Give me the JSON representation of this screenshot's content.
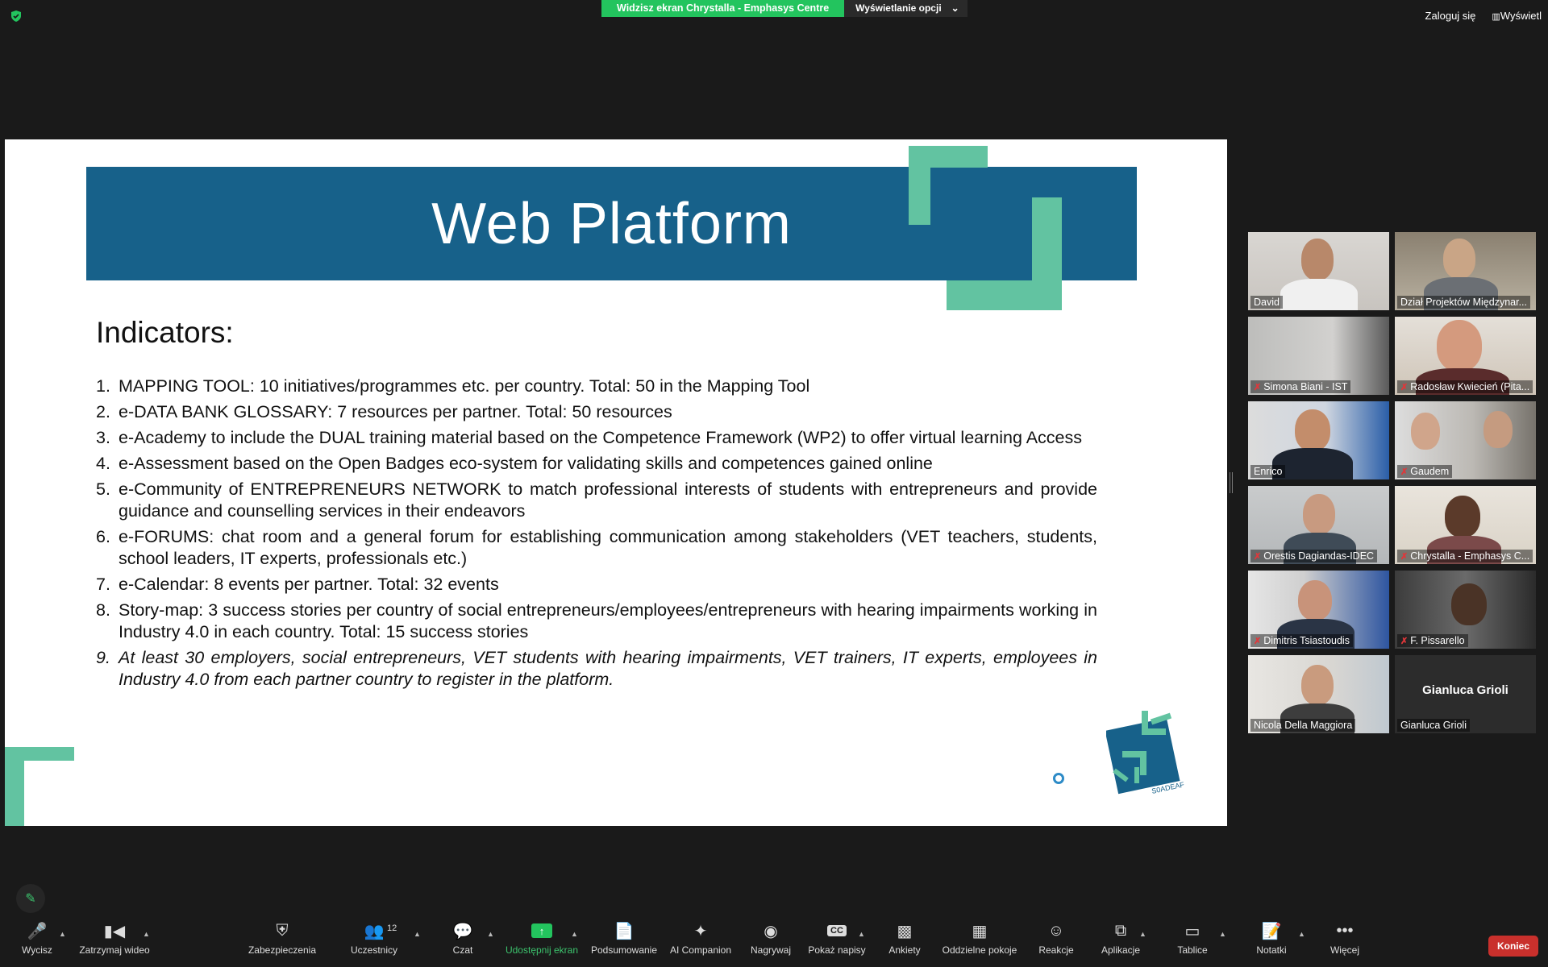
{
  "share_banner": {
    "text": "Widzisz ekran Chrystalla - Emphasys Centre",
    "options": "Wyświetlanie opcji"
  },
  "top_right": {
    "login": "Zaloguj się",
    "view": "Wyświetl"
  },
  "slide": {
    "title": "Web Platform",
    "heading": "Indicators:",
    "items": [
      {
        "num": "1.",
        "text": "MAPPING TOOL: 10 initiatives/programmes etc. per country. Total: 50 in the Mapping Tool"
      },
      {
        "num": "2.",
        "text": "e-DATA BANK GLOSSARY: 7 resources per partner. Total: 50 resources"
      },
      {
        "num": "3.",
        "text": "e-Academy to include the DUAL training material based on the Competence Framework (WP2) to offer virtual learning Access"
      },
      {
        "num": "4.",
        "text": "e-Assessment based on the Open Badges eco-system for validating skills and competences gained online"
      },
      {
        "num": "5.",
        "text": "e-Community of ENTREPRENEURS NETWORK to match professional interests of students with entrepreneurs and provide guidance and counselling services in their endeavors"
      },
      {
        "num": "6.",
        "text": "e-FORUMS: chat room and a general forum for establishing communication among stakeholders (VET teachers, students, school leaders, IT experts, professionals etc.)"
      },
      {
        "num": "7.",
        "text": "e-Calendar: 8 events per partner. Total: 32 events"
      },
      {
        "num": "8.",
        "text": "Story-map: 3 success stories per country of social entrepreneurs/employees/entrepreneurs with hearing impairments working in Industry 4.0 in each country. Total: 15 success stories"
      },
      {
        "num": "9.",
        "text": "At least 30 employers, social entrepreneurs, VET students with hearing impairments, VET trainers, IT experts, employees in Industry 4.0 from each partner country to register in the platform."
      }
    ],
    "logo_text": "S0ADEAF"
  },
  "participants": [
    {
      "name": "David",
      "muted": false
    },
    {
      "name": "Dział Projektów Międzynar...",
      "muted": false
    },
    {
      "name": "Simona Biani - IST",
      "muted": true
    },
    {
      "name": "Radosław Kwiecień (Pita...",
      "muted": true
    },
    {
      "name": "Enrico",
      "muted": false
    },
    {
      "name": "Gaudem",
      "muted": true
    },
    {
      "name": "Orestis Dagiandas-IDEC",
      "muted": true
    },
    {
      "name": "Chrystalla - Emphasys C...",
      "muted": true
    },
    {
      "name": "Dimitris Tsiastoudis",
      "muted": true
    },
    {
      "name": "F. Pissarello",
      "muted": true
    },
    {
      "name": "Nicola Della Maggiora",
      "muted": false
    },
    {
      "name": "Gianluca Grioli",
      "muted": false,
      "center": "Gianluca Grioli"
    }
  ],
  "toolbar": {
    "mute": "Wycisz",
    "video": "Zatrzymaj wideo",
    "security": "Zabezpieczenia",
    "participants": "Uczestnicy",
    "participants_count": "12",
    "chat": "Czat",
    "share": "Udostępnij ekran",
    "summary": "Podsumowanie",
    "ai": "AI Companion",
    "record": "Nagrywaj",
    "captions": "Pokaż napisy",
    "cc": "CC",
    "polls": "Ankiety",
    "breakout": "Oddzielne pokoje",
    "reactions": "Reakcje",
    "apps": "Aplikacje",
    "whiteboards": "Tablice",
    "notes": "Notatki",
    "more": "Więcej",
    "end": "Koniec"
  },
  "colors": {
    "accent_green": "#23c45e",
    "slide_band": "#17618a",
    "slide_deco": "#62c3a1",
    "end_red": "#c9302c"
  }
}
